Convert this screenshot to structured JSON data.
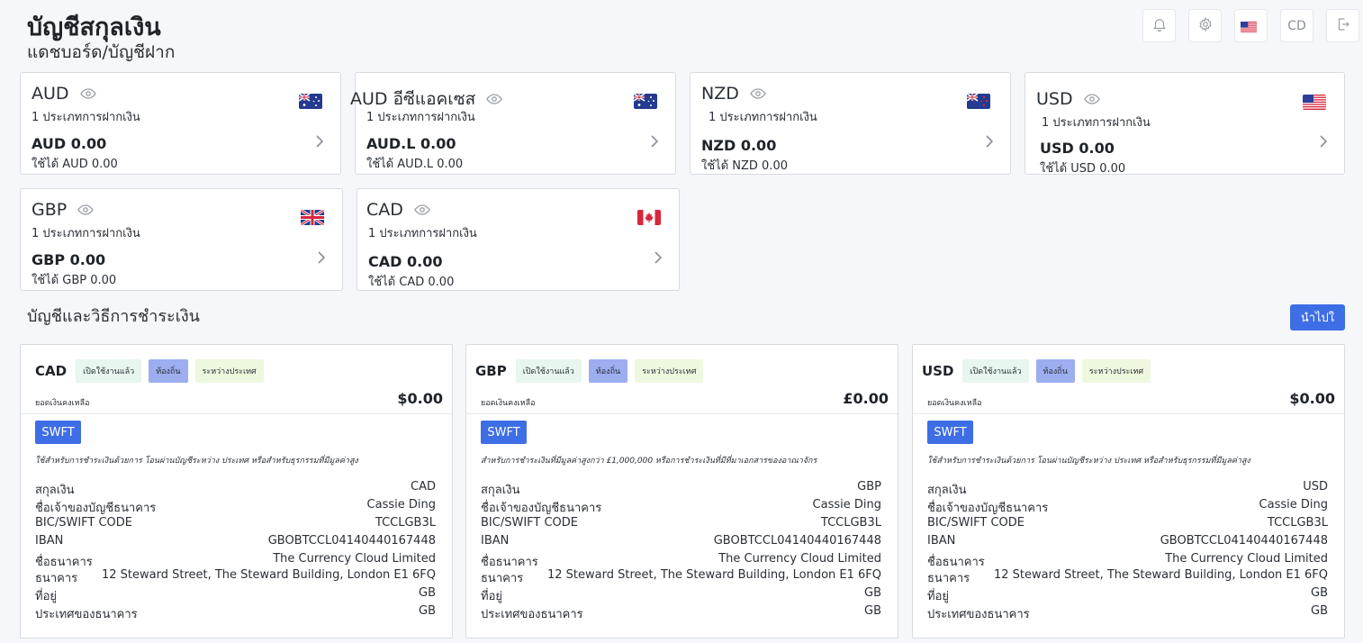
{
  "header": {
    "title": "บัญชีสกุลเงิน",
    "breadcrumb": "แดชบอร์ด/บัญชีฝาก",
    "avatar_initials": "CD"
  },
  "accounts": [
    {
      "code": "AUD",
      "types": "1 ประเภทการฝากเงิน",
      "balance": "AUD  0.00",
      "available": "ใช้ได้ AUD 0.00",
      "flag": "au-flag"
    },
    {
      "code": "AUD อีซีแอคเซส",
      "types": "1 ประเภทการฝากเงิน",
      "balance": "AUD.L  0.00",
      "available": "ใช้ได้ AUD.L 0.00",
      "flag": "au-flag"
    },
    {
      "code": "NZD",
      "types": "1 ประเภทการฝากเงิน",
      "balance": "NZD  0.00",
      "available": "ใช้ได้ NZD 0.00",
      "flag": "nz-flag"
    },
    {
      "code": "USD",
      "types": "1 ประเภทการฝากเงิน",
      "balance": "USD  0.00",
      "available": "ใช้ได้ USD 0.00",
      "flag": "us-flag"
    },
    {
      "code": "GBP",
      "types": "1 ประเภทการฝากเงิน",
      "balance": "GBP  0.00",
      "available": "ใช้ได้ GBP 0.00",
      "flag": "gb-flag"
    },
    {
      "code": "CAD",
      "types": "1 ประเภทการฝากเงิน",
      "balance": "CAD  0.00",
      "available": "ใช้ได้ CAD 0.00",
      "flag": "ca-flag"
    }
  ],
  "payments_section": {
    "title": "บัญชีและวิธีการชำระเงิน",
    "import_label": "นำไปใ"
  },
  "tags": {
    "active": "เปิดใช้งานแล้ว",
    "local": "ท้องถิ่น",
    "international": "ระหว่างประเทศ"
  },
  "labels": {
    "balance": "ยอดเงินคงเหลือ",
    "swift": "SWFT",
    "currency": "สกุลเงิน",
    "holder": "ชื่อเจ้าของบัญชีธนาคาร",
    "bic": "BIC/SWIFT CODE",
    "iban": "IBAN",
    "bank_name": "ชื่อธนาคาร",
    "bank_address": "ธนาคาร",
    "address": "ที่อยู่",
    "bank_country": "ประเทศของธนาคาร"
  },
  "bank_cards": [
    {
      "code": "CAD",
      "balance": "$0.00",
      "desc": "ใช้สำหรับการชำระเงินด้วยการ โอนผ่านบัญชีระหว่าง ประเทศ     หรือสำหรับธุรกรรมที่มีมูลค่าสูง",
      "currency": "CAD",
      "holder": "Cassie Ding",
      "bic": "TCCLGB3L",
      "iban": "GBOBTCCL04140440167448",
      "bank_name": "The Currency Cloud Limited",
      "bank_address": "12 Steward Street, The Steward Building, London E1 6FQ",
      "address": "GB",
      "bank_country": "GB"
    },
    {
      "code": "GBP",
      "balance": "£0.00",
      "desc": "สำหรับการชำระเงินที่มีมูลค่าสูงกว่า     £1,000,000  หรือการชำระเงินที่มีที่มาเอกสารของอาณาจักร",
      "currency": "GBP",
      "holder": "Cassie Ding",
      "bic": "TCCLGB3L",
      "iban": "GBOBTCCL04140440167448",
      "bank_name": "The Currency Cloud Limited",
      "bank_address": "12 Steward Street, The Steward Building, London E1 6FQ",
      "address": "GB",
      "bank_country": "GB"
    },
    {
      "code": "USD",
      "balance": "$0.00",
      "desc": "ใช้สำหรับการชำระเงินด้วยการ โอนผ่านบัญชีระหว่าง ประเทศ     หรือสำหรับธุรกรรมที่มีมูลค่าสูง",
      "currency": "USD",
      "holder": "Cassie Ding",
      "bic": "TCCLGB3L",
      "iban": "GBOBTCCL04140440167448",
      "bank_name": "The Currency Cloud Limited",
      "bank_address": "12 Steward Street, The Steward Building, London E1 6FQ",
      "address": "GB",
      "bank_country": "GB"
    }
  ]
}
